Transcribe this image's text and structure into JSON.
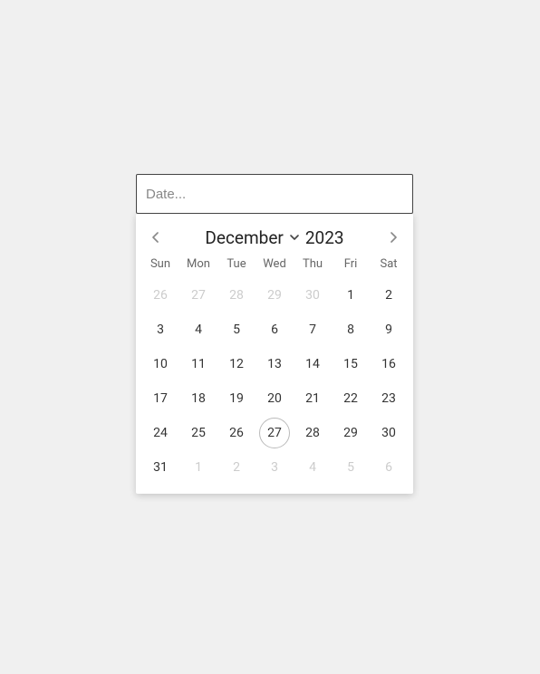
{
  "input": {
    "placeholder": "Date..."
  },
  "calendar": {
    "month": "December",
    "year": "2023",
    "dow": [
      "Sun",
      "Mon",
      "Tue",
      "Wed",
      "Thu",
      "Fri",
      "Sat"
    ],
    "days": [
      {
        "d": "26",
        "out": true
      },
      {
        "d": "27",
        "out": true
      },
      {
        "d": "28",
        "out": true
      },
      {
        "d": "29",
        "out": true
      },
      {
        "d": "30",
        "out": true
      },
      {
        "d": "1"
      },
      {
        "d": "2"
      },
      {
        "d": "3"
      },
      {
        "d": "4"
      },
      {
        "d": "5"
      },
      {
        "d": "6"
      },
      {
        "d": "7"
      },
      {
        "d": "8"
      },
      {
        "d": "9"
      },
      {
        "d": "10"
      },
      {
        "d": "11"
      },
      {
        "d": "12"
      },
      {
        "d": "13"
      },
      {
        "d": "14"
      },
      {
        "d": "15"
      },
      {
        "d": "16"
      },
      {
        "d": "17"
      },
      {
        "d": "18"
      },
      {
        "d": "19"
      },
      {
        "d": "20"
      },
      {
        "d": "21"
      },
      {
        "d": "22"
      },
      {
        "d": "23"
      },
      {
        "d": "24"
      },
      {
        "d": "25"
      },
      {
        "d": "26"
      },
      {
        "d": "27",
        "today": true
      },
      {
        "d": "28"
      },
      {
        "d": "29"
      },
      {
        "d": "30"
      },
      {
        "d": "31"
      },
      {
        "d": "1",
        "out": true
      },
      {
        "d": "2",
        "out": true
      },
      {
        "d": "3",
        "out": true
      },
      {
        "d": "4",
        "out": true
      },
      {
        "d": "5",
        "out": true
      },
      {
        "d": "6",
        "out": true
      }
    ]
  }
}
